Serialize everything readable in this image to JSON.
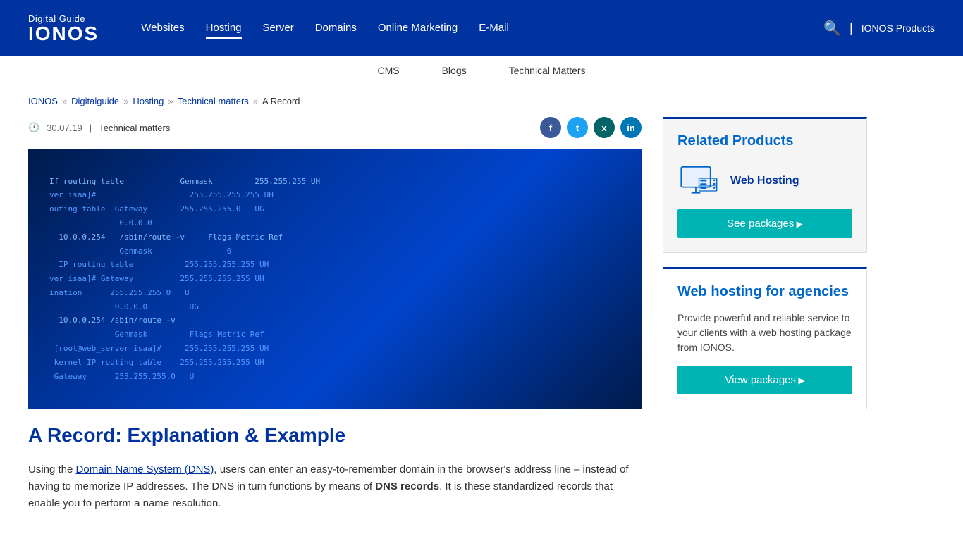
{
  "header": {
    "logo_guide": "Digital Guide",
    "logo_brand": "IONOS",
    "nav_items": [
      {
        "label": "Websites",
        "active": false
      },
      {
        "label": "Hosting",
        "active": true
      },
      {
        "label": "Server",
        "active": false
      },
      {
        "label": "Domains",
        "active": false
      },
      {
        "label": "Online Marketing",
        "active": false
      },
      {
        "label": "E-Mail",
        "active": false
      }
    ],
    "ionos_products": "IONOS Products"
  },
  "secondary_nav": {
    "items": [
      {
        "label": "CMS"
      },
      {
        "label": "Blogs"
      },
      {
        "label": "Technical Matters"
      }
    ]
  },
  "breadcrumb": {
    "items": [
      {
        "label": "IONOS"
      },
      {
        "label": "Digitalguide"
      },
      {
        "label": "Hosting"
      },
      {
        "label": "Technical matters"
      },
      {
        "label": "A Record"
      }
    ],
    "separator": "»"
  },
  "article": {
    "date": "30.07.19",
    "separator": "|",
    "category": "Technical matters",
    "title": "A Record: Explanation & Example",
    "body_intro": "Using the ",
    "body_link": "Domain Name System (DNS)",
    "body_text1": ", users can enter an easy-to-remember domain in the browser's address line – instead of having to memorize IP addresses. The DNS in turn functions by means of ",
    "body_bold": "DNS records",
    "body_text2": ". It is these standardized records that enable you to perform a name resolution."
  },
  "terminal": {
    "lines": [
      "If routing table            Genmask         255.255.255 UH",
      "ver isaa]#                  255.255.255.255 UH",
      "outing table  Gateway       255.255.255.0   UG",
      "               0.0.0.0",
      "               0.0.0.0",
      "  10.0.0.254   /sbin/route -v     Flags Metric Ref",
      "               Genmask             0",
      "  IP routing table           255.255.255.255 UH",
      "ver isaa]#  Gateway         255.255.255.255 UH",
      "ination      255.255.255.0   U",
      "              0.0.0.0        UG",
      "  10.0.0.254  /sbin/route -v",
      "              Genmask        Flags Metric Ref",
      " [root@web_server isaa]#     255.255.255.255 UH",
      " kernel IP routing table    255.255.255.255 UH",
      " Gateway      255.255.255.0   U"
    ]
  },
  "sidebar": {
    "card1": {
      "title": "Related Products",
      "product_name": "Web Hosting",
      "btn_label": "See packages"
    },
    "card2": {
      "title": "Web hosting for agencies",
      "description": "Provide powerful and reliable service to your clients with a web hosting package from IONOS.",
      "btn_label": "View packages"
    }
  },
  "social": {
    "facebook": "f",
    "twitter": "t",
    "xing": "x",
    "linkedin": "in"
  }
}
